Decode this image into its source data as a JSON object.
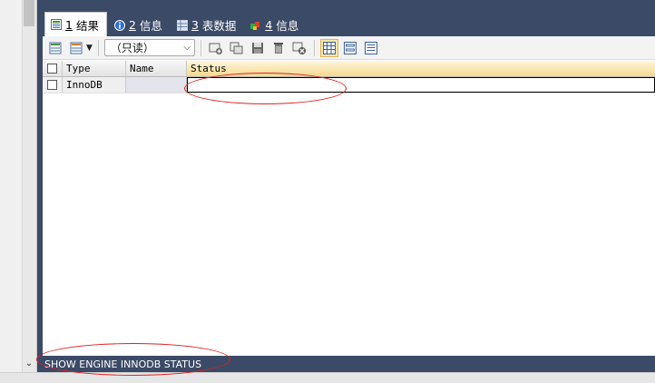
{
  "tabs": [
    {
      "num": "1",
      "label": "结果",
      "active": true,
      "icon": "result-grid-icon"
    },
    {
      "num": "2",
      "label": "信息",
      "active": false,
      "icon": "info-icon"
    },
    {
      "num": "3",
      "label": "表数据",
      "active": false,
      "icon": "table-data-icon"
    },
    {
      "num": "4",
      "label": "信息",
      "active": false,
      "icon": "info-flag-icon"
    }
  ],
  "toolbar": {
    "readonly_select": "（只读）",
    "icons": [
      "export-grid-icon",
      "import-dropdown-icon",
      "add-row-icon",
      "duplicate-row-icon",
      "save-icon",
      "delete-icon",
      "cancel-icon",
      "grid-view-icon",
      "form-view-icon",
      "text-view-icon"
    ]
  },
  "grid": {
    "columns": [
      "Type",
      "Name",
      "Status"
    ],
    "rows": [
      {
        "Type": "InnoDB",
        "Name": "",
        "Status": ""
      }
    ]
  },
  "status_bar": {
    "query": "SHOW ENGINE INNODB STATUS"
  },
  "colors": {
    "panel_chrome": "#3b4a66",
    "annotation": "#e02020",
    "header_highlight": "#f6d98e"
  }
}
